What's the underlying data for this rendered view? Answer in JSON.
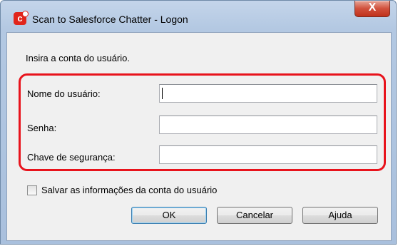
{
  "window": {
    "title": "Scan to Salesforce Chatter - Logon",
    "close_glyph": "X",
    "app_icon": "salesforce-chatter-icon"
  },
  "dialog": {
    "prompt": "Insira a conta do usuário.",
    "fields": [
      {
        "label": "Nome do usuário:",
        "value": ""
      },
      {
        "label": "Senha:",
        "value": ""
      },
      {
        "label": "Chave de segurança:",
        "value": ""
      }
    ],
    "checkbox": {
      "label": "Salvar as informações da conta do usuário",
      "checked": false
    },
    "buttons": {
      "ok": "OK",
      "cancel": "Cancelar",
      "help": "Ajuda"
    }
  },
  "colors": {
    "highlight": "#e8131c",
    "titlebar": "#b3c8e2",
    "close": "#c0311b"
  }
}
